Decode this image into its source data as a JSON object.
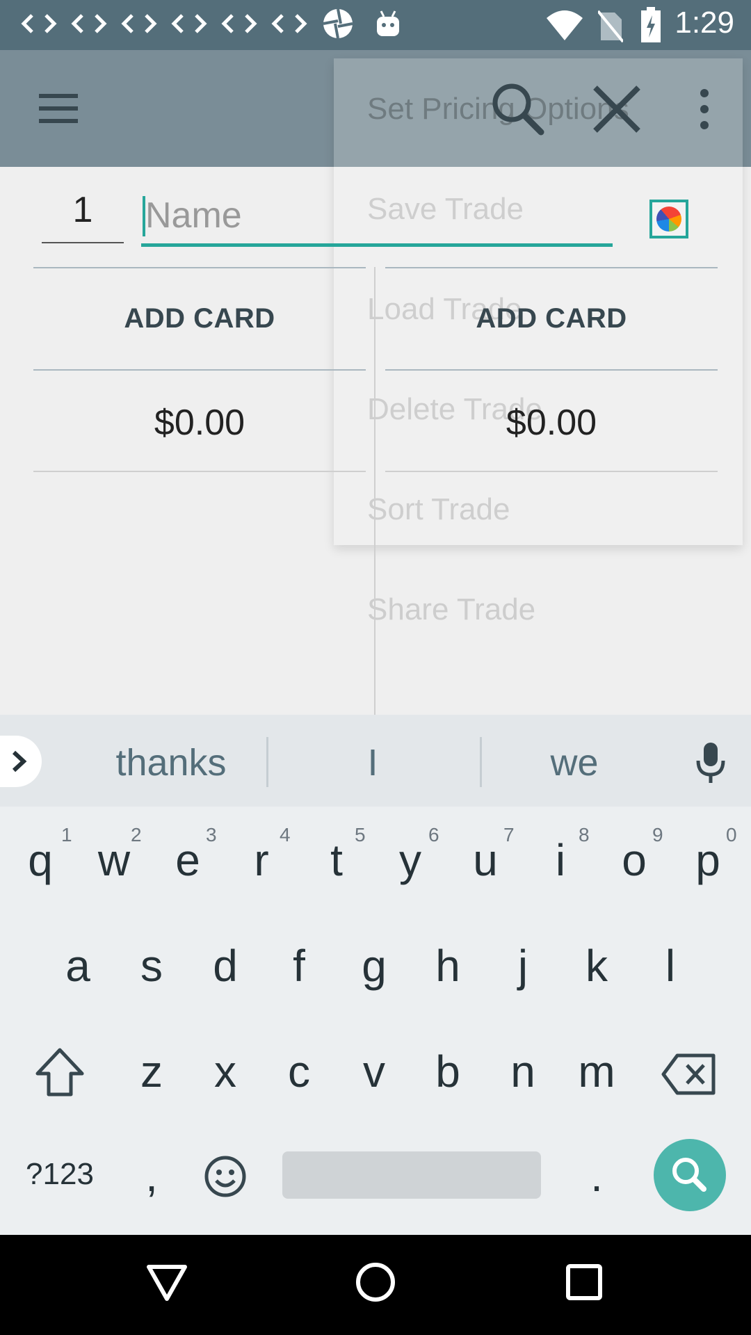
{
  "status_bar": {
    "time": "1:29",
    "notification_icons": [
      "code-icon",
      "code-icon",
      "code-icon",
      "code-icon",
      "code-icon",
      "code-icon",
      "aperture-icon",
      "android-icon"
    ],
    "system_icons": [
      "wifi-icon",
      "no-sim-icon",
      "battery-charging-icon"
    ]
  },
  "toolbar": {
    "icons": [
      "menu-icon",
      "search-icon",
      "close-icon",
      "more-vert-icon"
    ]
  },
  "overflow_menu": {
    "items": [
      "Set Pricing Options",
      "Save Trade",
      "Load Trade",
      "Delete Trade",
      "Sort Trade",
      "Share Trade"
    ]
  },
  "trade_form": {
    "quantity": "1",
    "name_placeholder": "Name",
    "name_value": ""
  },
  "left_column": {
    "add_label": "ADD CARD",
    "total": "$0.00"
  },
  "right_column": {
    "add_label": "ADD CARD",
    "total": "$0.00"
  },
  "suggestions": [
    "thanks",
    "I",
    "we"
  ],
  "keyboard": {
    "row1": [
      "q",
      "w",
      "e",
      "r",
      "t",
      "y",
      "u",
      "i",
      "o",
      "p"
    ],
    "row1_hints": [
      "1",
      "2",
      "3",
      "4",
      "5",
      "6",
      "7",
      "8",
      "9",
      "0"
    ],
    "row2": [
      "a",
      "s",
      "d",
      "f",
      "g",
      "h",
      "j",
      "k",
      "l"
    ],
    "row3": [
      "z",
      "x",
      "c",
      "v",
      "b",
      "n",
      "m"
    ],
    "symbols_label": "?123",
    "comma": ",",
    "period": "."
  },
  "colors": {
    "accent": "#26a69a",
    "toolbar": "#546e7a",
    "search_key": "#4db6ac"
  }
}
